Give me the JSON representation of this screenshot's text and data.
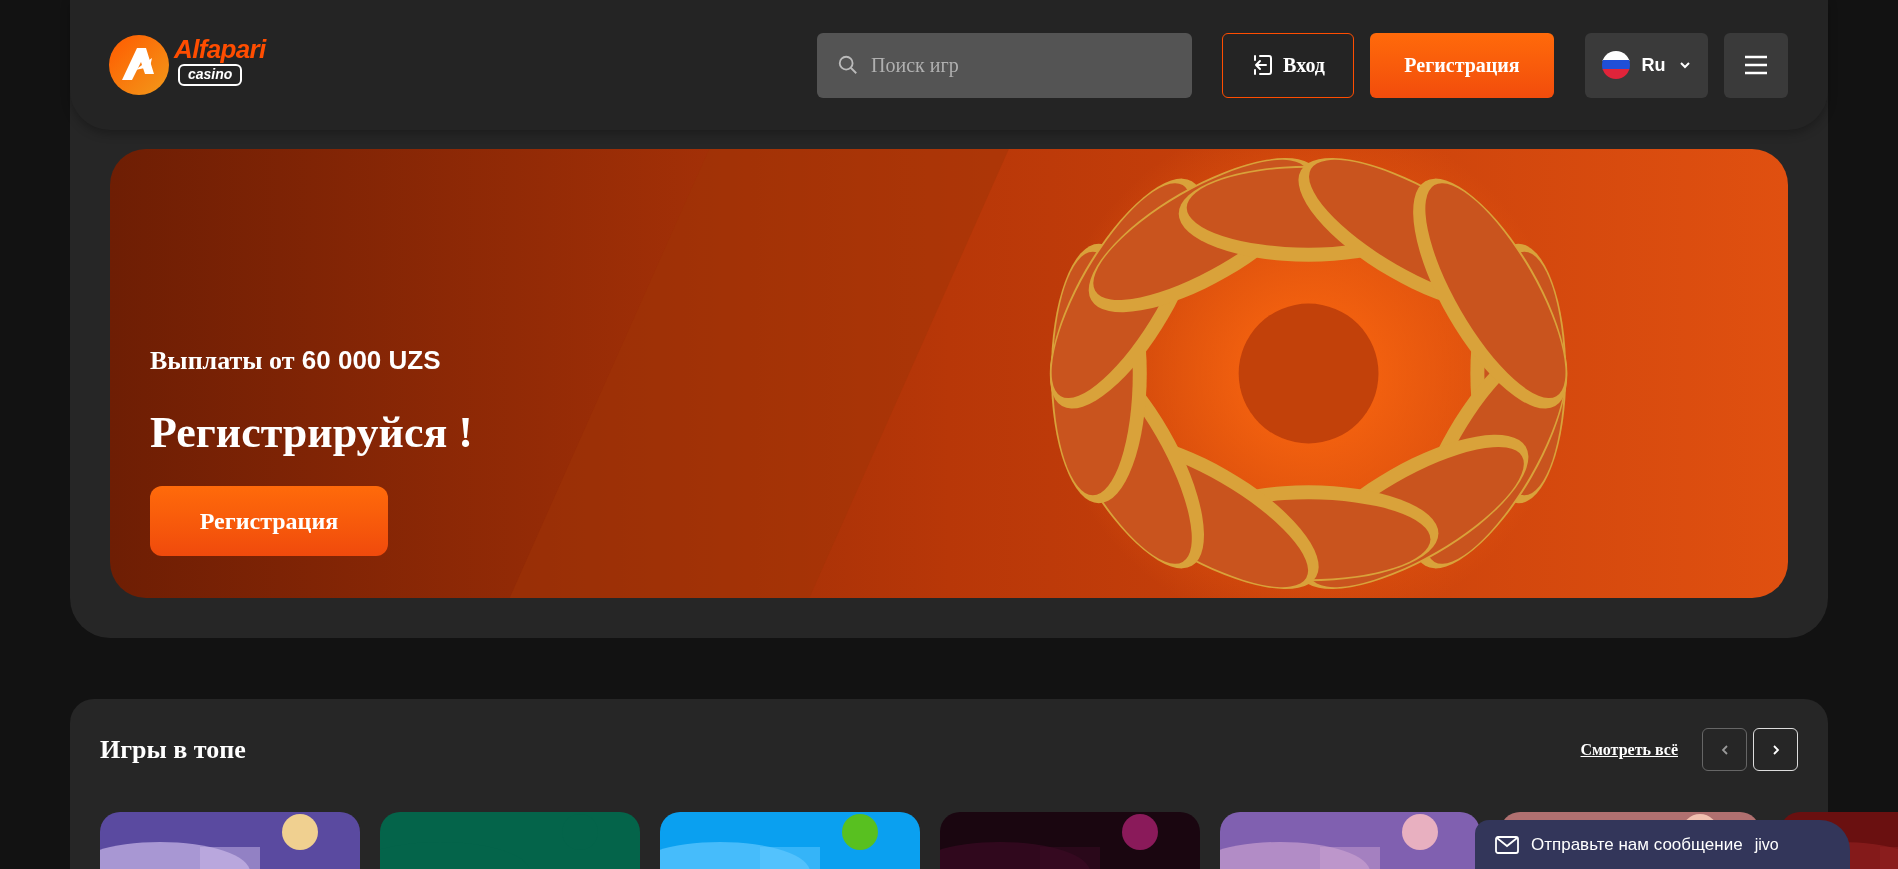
{
  "header": {
    "logo": {
      "brand": "Alfapari",
      "badge": "casino"
    },
    "search": {
      "placeholder": "Поиск игр"
    },
    "login_button": "Вход",
    "register_button": "Регистрация",
    "language": {
      "code": "Ru"
    }
  },
  "banner": {
    "kind": "picture",
    "subtitle": {
      "prefix": "Выплаты от",
      "amount": "60 000 UZS"
    },
    "title": "Регистрируйся !",
    "button": "Регистрация"
  },
  "top_games": {
    "title": "Игры в топе",
    "see_all": "Смотреть всё"
  },
  "chat": {
    "label": "Отправьте нам сообщение",
    "brand": "jivo"
  }
}
